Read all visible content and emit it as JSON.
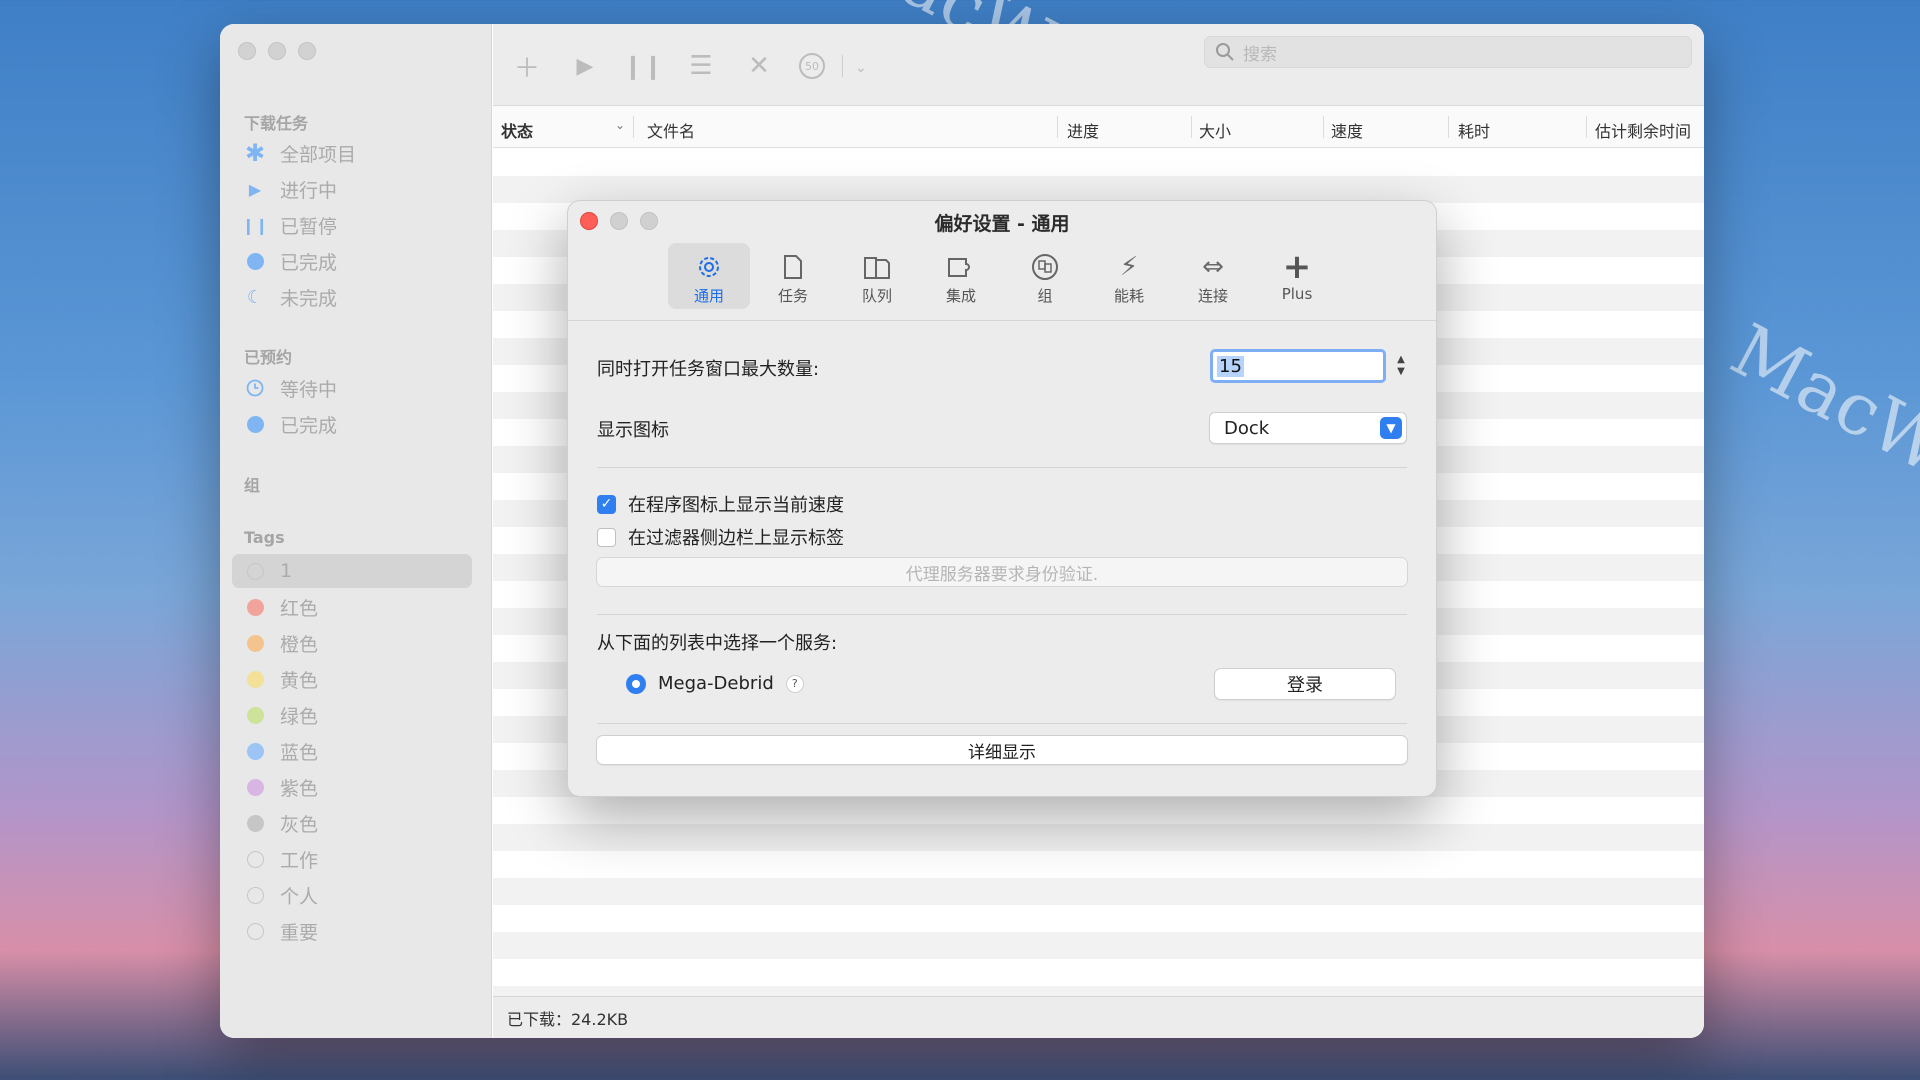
{
  "watermark": "MacW.com",
  "sidebar": {
    "sections": {
      "downloads": "下载任务",
      "scheduled": "已预约",
      "groups": "组",
      "tags": "Tags"
    },
    "download_items": [
      {
        "label": "全部项目",
        "icon": "asterisk-icon",
        "color": "#7fb5f3"
      },
      {
        "label": "进行中",
        "icon": "play-icon",
        "color": "#7fb5f3"
      },
      {
        "label": "已暂停",
        "icon": "pause-icon",
        "color": "#7fb5f3"
      },
      {
        "label": "已完成",
        "icon": "circle-icon",
        "color": "#7fb5f3"
      },
      {
        "label": "未完成",
        "icon": "moon-icon",
        "color": "#7fb5f3"
      }
    ],
    "scheduled_items": [
      {
        "label": "等待中",
        "icon": "clock-icon",
        "color": "#7fb5f3"
      },
      {
        "label": "已完成",
        "icon": "circle-icon",
        "color": "#7fb5f3"
      }
    ],
    "tag_items": [
      {
        "label": "1",
        "color": "",
        "selected": true
      },
      {
        "label": "红色",
        "color": "#f2a39c"
      },
      {
        "label": "橙色",
        "color": "#f3c48e"
      },
      {
        "label": "黄色",
        "color": "#f3e197"
      },
      {
        "label": "绿色",
        "color": "#cfe29a"
      },
      {
        "label": "蓝色",
        "color": "#9cc4f4"
      },
      {
        "label": "紫色",
        "color": "#d9b5e3"
      },
      {
        "label": "灰色",
        "color": "#c6c6c6"
      },
      {
        "label": "工作",
        "color": ""
      },
      {
        "label": "个人",
        "color": ""
      },
      {
        "label": "重要",
        "color": ""
      }
    ]
  },
  "toolbar": {
    "speed_badge": "50",
    "search_placeholder": "搜索"
  },
  "table": {
    "columns": [
      "状态",
      "文件名",
      "进度",
      "大小",
      "速度",
      "耗时",
      "估计剩余时间"
    ]
  },
  "status": {
    "downloaded": "已下载：24.2KB"
  },
  "dialog": {
    "title": "偏好设置 - 通用",
    "tabs": [
      {
        "label": "通用",
        "icon": "gear-icon",
        "active": true
      },
      {
        "label": "任务",
        "icon": "document-icon"
      },
      {
        "label": "队列",
        "icon": "queue-icon"
      },
      {
        "label": "集成",
        "icon": "puzzle-icon"
      },
      {
        "label": "组",
        "icon": "group-icon"
      },
      {
        "label": "能耗",
        "icon": "bolt-icon"
      },
      {
        "label": "连接",
        "icon": "arrows-icon"
      },
      {
        "label": "Plus",
        "icon": "plus-icon"
      }
    ],
    "max_windows_label": "同时打开任务窗口最大数量:",
    "max_windows_value": "15",
    "show_icon_label": "显示图标",
    "show_icon_value": "Dock",
    "checkbox_speed": "在程序图标上显示当前速度",
    "checkbox_speed_checked": true,
    "checkbox_tags": "在过滤器侧边栏上显示标签",
    "checkbox_tags_checked": false,
    "proxy_button": "代理服务器要求身份验证.",
    "service_prompt": "从下面的列表中选择一个服务:",
    "service_name": "Mega-Debrid",
    "help_mark": "?",
    "login_button": "登录",
    "details_button": "详细显示"
  }
}
